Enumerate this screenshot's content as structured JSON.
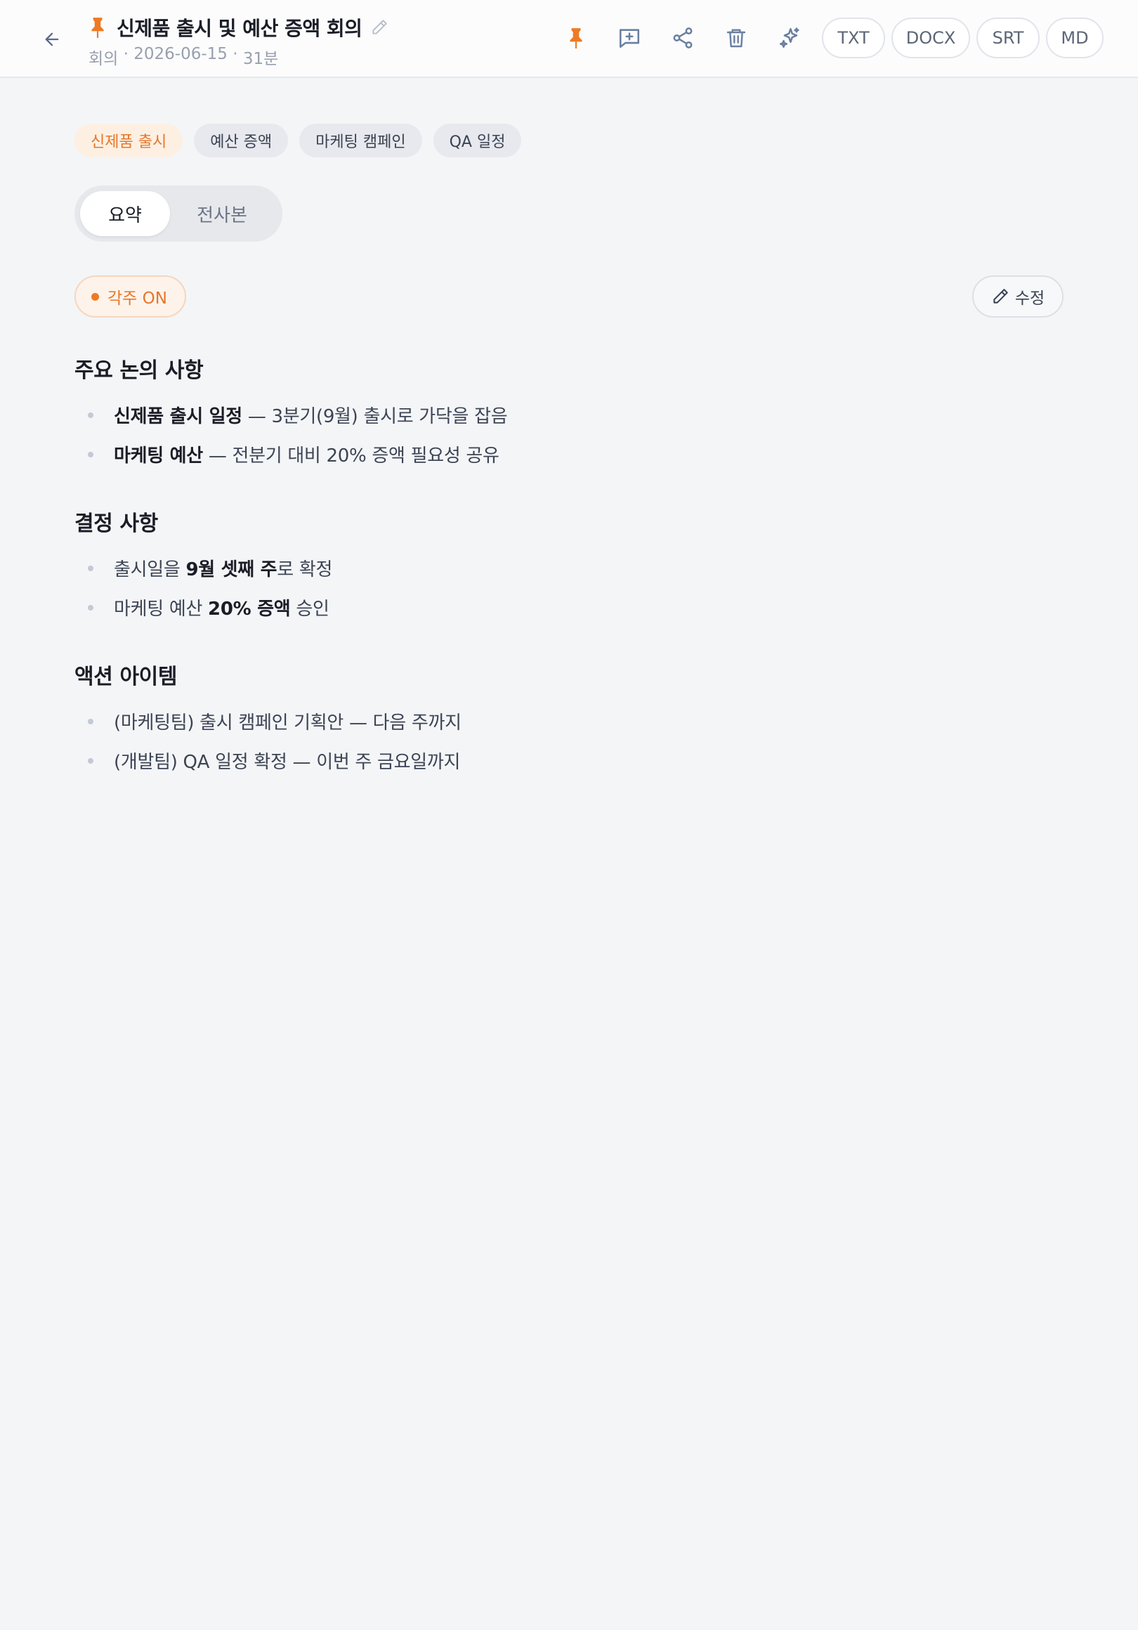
{
  "header": {
    "title": "신제품 출시 및 예산 증액 회의",
    "meta": {
      "category": "회의",
      "separator": " · ",
      "date": "2026-06-15",
      "duration": "31분"
    },
    "icons": {
      "back": "arrow-left-icon",
      "title_pin": "pin-icon",
      "title_edit": "pencil-icon"
    },
    "toolbar": [
      {
        "name": "pin-toggle",
        "icon": "pin-icon",
        "active_color": "#ee7a24"
      },
      {
        "name": "comment",
        "icon": "message-plus-icon"
      },
      {
        "name": "share",
        "icon": "share-icon"
      },
      {
        "name": "delete",
        "icon": "trash-icon"
      },
      {
        "name": "ai",
        "icon": "sparkles-icon"
      }
    ],
    "export": [
      "TXT",
      "DOCX",
      "SRT",
      "MD"
    ]
  },
  "tags": [
    {
      "label": "신제품 출시",
      "active": true
    },
    {
      "label": "예산 증액",
      "active": false
    },
    {
      "label": "마케팅 캠페인",
      "active": false
    },
    {
      "label": "QA 일정",
      "active": false
    }
  ],
  "view_tabs": {
    "summary": "요약",
    "transcript": "전사본",
    "selected": "summary"
  },
  "footnote_toggle": "각주 ON",
  "edit_button": "수정",
  "sections": {
    "discussion": {
      "heading": "주요 논의 사항",
      "items": [
        {
          "strong": "신제품 출시 일정",
          "text": " — 3분기(9월) 출시로 가닥을 잡음"
        },
        {
          "strong": "마케팅 예산",
          "text": " — 전분기 대비 20% 증액 필요성 공유"
        }
      ]
    },
    "decisions": {
      "heading": "결정 사항",
      "items": [
        {
          "pre": "출시일을 ",
          "strong": "9월 셋째 주",
          "post": "로 확정"
        },
        {
          "pre": "마케팅 예산 ",
          "strong": "20% 증액",
          "post": " 승인"
        }
      ]
    },
    "actions": {
      "heading": "액션 아이템",
      "items": [
        {
          "text": "(마케팅팀) 출시 캠페인 기획안 — 다음 주까지"
        },
        {
          "text": "(개발팀) QA 일정 확정 — 이번 주 금요일까지"
        }
      ]
    }
  },
  "colors": {
    "accent": "#ee7a24",
    "background": "#f4f5f7",
    "header_bg": "#fcfcfd",
    "icon": "#6a7fa0"
  }
}
